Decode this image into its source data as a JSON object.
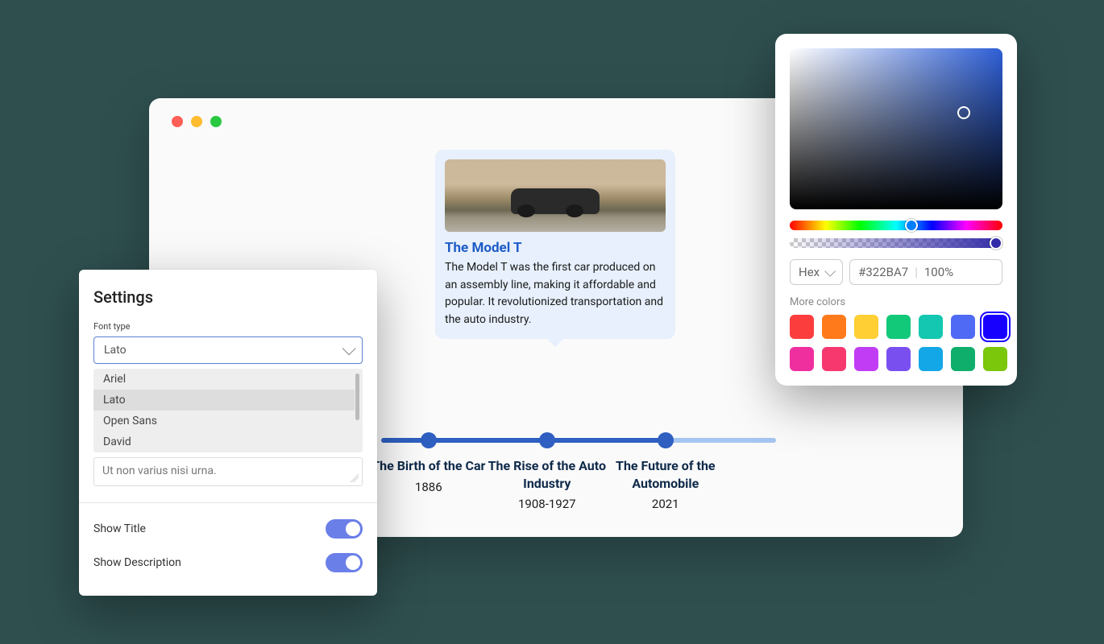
{
  "browser": {
    "card": {
      "title": "The Model T",
      "description": "The Model T was the first car produced on an assembly line, making it affordable and popular. It revolutionized transportation and the auto industry."
    },
    "timeline": {
      "items": [
        {
          "title": "The Birth of the Car",
          "year": "1886",
          "pos": 12
        },
        {
          "title": "The Rise of the Auto Industry",
          "year": "1908-1927",
          "pos": 42
        },
        {
          "title": "The Future of the Automobile",
          "year": "2021",
          "pos": 72
        }
      ],
      "fill_pct": 72
    }
  },
  "settings": {
    "title": "Settings",
    "font_type_label": "Font type",
    "font_selected": "Lato",
    "font_options": [
      "Ariel",
      "Lato",
      "Open Sans",
      "David"
    ],
    "font_options_selected_index": 1,
    "textarea_value": "Ut non varius nisi urna.",
    "show_title_label": "Show Title",
    "show_title_on": true,
    "show_description_label": "Show Description",
    "show_description_on": true
  },
  "picker": {
    "format_label": "Hex",
    "hex_value": "#322BA7",
    "alpha_value": "100%",
    "more_colors_label": "More colors",
    "swatches": [
      {
        "color": "#fc3d3d",
        "active": false
      },
      {
        "color": "#ff7a1a",
        "active": false
      },
      {
        "color": "#ffcf33",
        "active": false
      },
      {
        "color": "#12c97a",
        "active": false
      },
      {
        "color": "#14c7b0",
        "active": false
      },
      {
        "color": "#4f6af5",
        "active": false
      },
      {
        "color": "#1800ff",
        "active": true
      },
      {
        "color": "#f02f9f",
        "active": false
      },
      {
        "color": "#f6386f",
        "active": false
      },
      {
        "color": "#c13df5",
        "active": false
      },
      {
        "color": "#7a4ff0",
        "active": false
      },
      {
        "color": "#13a7e8",
        "active": false
      },
      {
        "color": "#0fae6b",
        "active": false
      },
      {
        "color": "#7ac70c",
        "active": false
      }
    ]
  }
}
